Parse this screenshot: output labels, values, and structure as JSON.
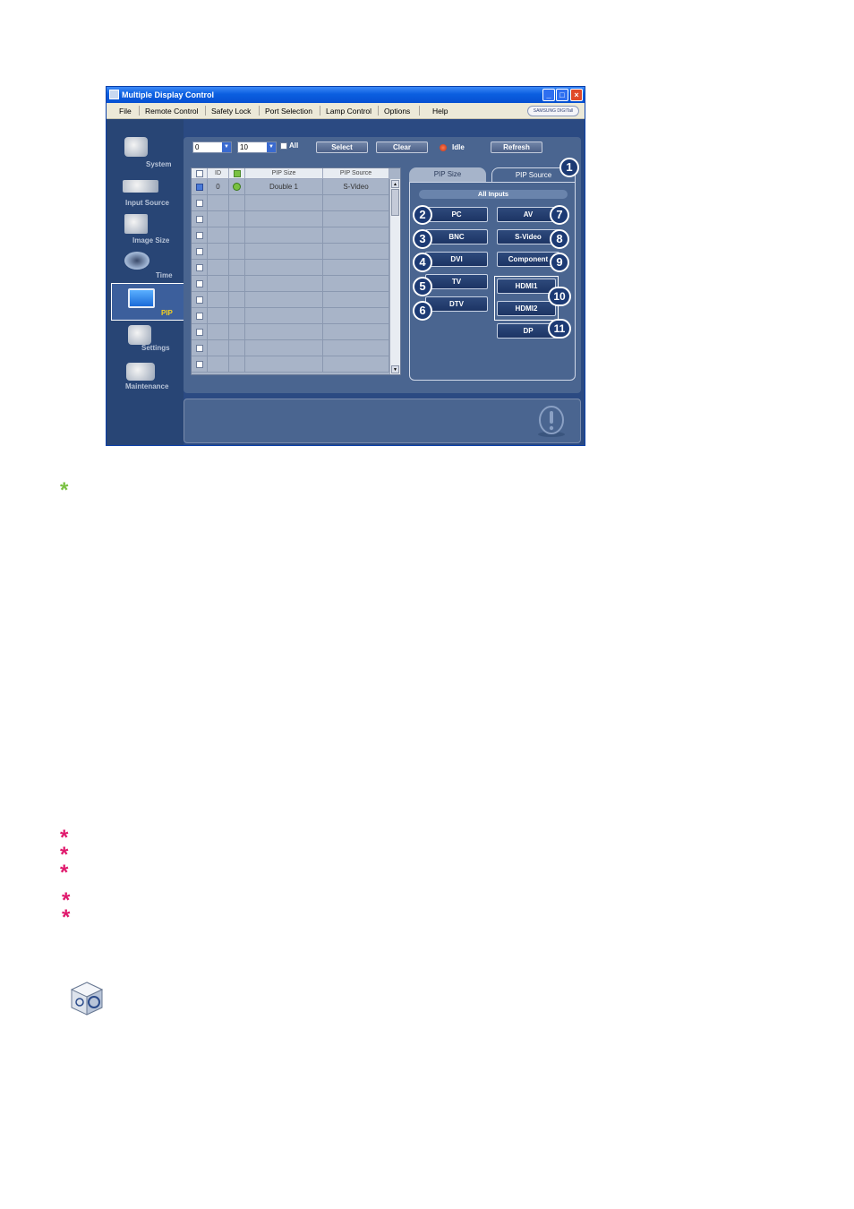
{
  "window": {
    "title": "Multiple Display Control",
    "controls": {
      "minimize": "_",
      "maximize": "□",
      "close": "×"
    }
  },
  "menu": {
    "items": [
      "File",
      "Remote Control",
      "Safety Lock",
      "Port Selection",
      "Lamp Control",
      "Options",
      "Help"
    ],
    "brand": "SAMSUNG DIGITall"
  },
  "sidebar": {
    "items": [
      {
        "label": "System",
        "icon": "camera-icon"
      },
      {
        "label": "Input Source",
        "icon": "input-device-icon"
      },
      {
        "label": "Image Size",
        "icon": "image-size-icon"
      },
      {
        "label": "Time",
        "icon": "clock-icon"
      },
      {
        "label": "PIP",
        "icon": "pip-monitor-icon",
        "active": true
      },
      {
        "label": "Settings",
        "icon": "settings-cube-icon"
      },
      {
        "label": "Maintenance",
        "icon": "maintenance-icon"
      }
    ]
  },
  "toolbar": {
    "from_value": "0",
    "to_value": "10",
    "all_label": "All",
    "select_label": "Select",
    "clear_label": "Clear",
    "status": "Idle",
    "refresh_label": "Refresh"
  },
  "grid": {
    "columns": [
      "",
      "ID",
      "",
      "PIP Size",
      "PIP Source"
    ],
    "rows": [
      {
        "checked": true,
        "id": "0",
        "status": "on",
        "pip_size": "Double 1",
        "pip_source": "S-Video"
      },
      {
        "checked": false,
        "id": "",
        "status": "",
        "pip_size": "",
        "pip_source": ""
      },
      {
        "checked": false,
        "id": "",
        "status": "",
        "pip_size": "",
        "pip_source": ""
      },
      {
        "checked": false,
        "id": "",
        "status": "",
        "pip_size": "",
        "pip_source": ""
      },
      {
        "checked": false,
        "id": "",
        "status": "",
        "pip_size": "",
        "pip_source": ""
      },
      {
        "checked": false,
        "id": "",
        "status": "",
        "pip_size": "",
        "pip_source": ""
      },
      {
        "checked": false,
        "id": "",
        "status": "",
        "pip_size": "",
        "pip_source": ""
      },
      {
        "checked": false,
        "id": "",
        "status": "",
        "pip_size": "",
        "pip_source": ""
      },
      {
        "checked": false,
        "id": "",
        "status": "",
        "pip_size": "",
        "pip_source": ""
      },
      {
        "checked": false,
        "id": "",
        "status": "",
        "pip_size": "",
        "pip_source": ""
      },
      {
        "checked": false,
        "id": "",
        "status": "",
        "pip_size": "",
        "pip_source": ""
      },
      {
        "checked": false,
        "id": "",
        "status": "",
        "pip_size": "",
        "pip_source": ""
      }
    ]
  },
  "tabs": {
    "pip_size": "PIP Size",
    "pip_source": "PIP Source"
  },
  "sources": {
    "header": "All Inputs",
    "left": [
      "PC",
      "BNC",
      "DVI",
      "TV",
      "DTV"
    ],
    "right": [
      "AV",
      "S-Video",
      "Component",
      "HDMI1",
      "HDMI2",
      "DP"
    ]
  },
  "callouts": [
    "1",
    "2",
    "3",
    "4",
    "5",
    "6",
    "7",
    "8",
    "9",
    "10",
    "11"
  ],
  "colors": {
    "window_bg": "#2b4a82",
    "panel": "#4a6590",
    "active_label": "#f4d020",
    "green_star": "#7ac142",
    "pink_star": "#e0186c"
  },
  "page": {
    "stars": [
      "*",
      "*",
      "*",
      "*",
      "*",
      "*"
    ]
  }
}
